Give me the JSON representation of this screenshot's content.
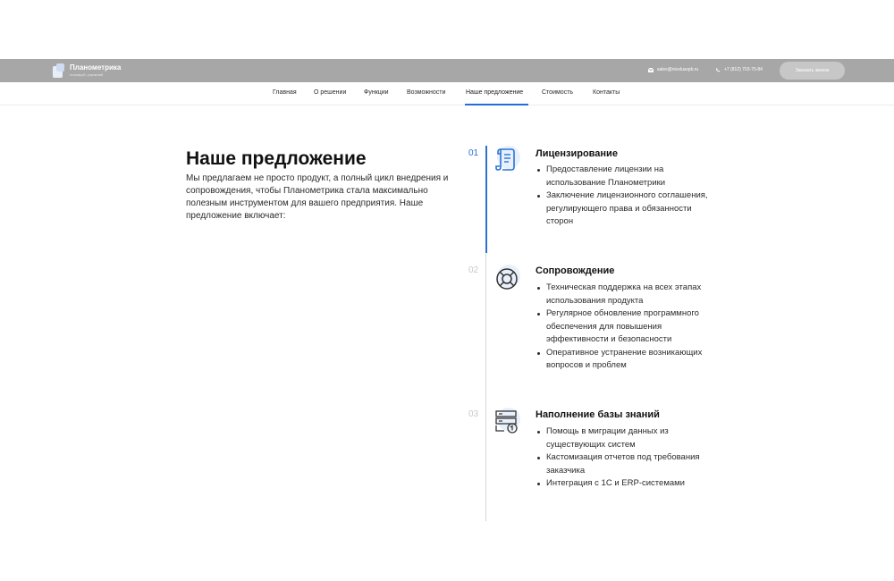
{
  "header": {
    "brand_name": "Планометрика",
    "brand_tagline": "планируй. управляй",
    "email": "sales@nicelusspb.ru",
    "phone": "+7 (812) 703-75-84",
    "order_button": "Заказать звонок",
    "bar_color": "#a7a7a7"
  },
  "nav": {
    "items": [
      {
        "label": "Главная"
      },
      {
        "label": "О решении"
      },
      {
        "label": "Функции"
      },
      {
        "label": "Возможности"
      },
      {
        "label": "Наше предложение",
        "active": true
      },
      {
        "label": "Стоимость"
      },
      {
        "label": "Контакты"
      }
    ],
    "accent_color": "#1f6fd6"
  },
  "intro": {
    "title": "Наше предложение",
    "text": "Мы предлагаем не просто продукт, а полный цикл внедрения и сопровождения, чтобы Планометрика стала максимально полезным инструментом для вашего предприятия. Наше предложение включает:"
  },
  "steps": [
    {
      "number": "01",
      "icon": "scroll-icon",
      "title": "Лицензирование",
      "items": [
        "Предоставление лицензии на использование Планометрики",
        "Заключение лицензионного соглашения, регулирующего права и обязанности сторон"
      ]
    },
    {
      "number": "02",
      "icon": "lifebuoy-icon",
      "title": "Сопровождение",
      "items": [
        "Техническая поддержка на всех этапах использования продукта",
        "Регулярное обновление программного обеспечения для повышения эффективности и безопасности",
        "Оперативное устранение возникающих вопросов и проблем"
      ]
    },
    {
      "number": "03",
      "icon": "server-sync-icon",
      "title": "Наполнение базы знаний",
      "items": [
        "Помощь в миграции данных из существующих систем",
        "Кастомизация отчетов под требования заказчика",
        "Интеграция с 1С и ERP-системами"
      ]
    }
  ]
}
